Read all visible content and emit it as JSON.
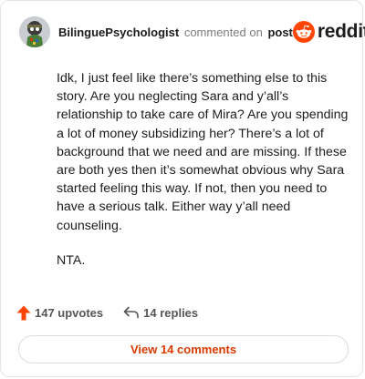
{
  "header": {
    "username": "BilinguePsychologist",
    "commented_text": "commented on",
    "post_link": "post",
    "brand": "reddit"
  },
  "comment": {
    "paragraphs": [
      "Idk, I just feel like there’s something else to this story. Are you neglecting Sara and y’all’s relationship to take care of Mira? Are you spending a lot of money subsidizing her? There’s a lot of background that we need and are missing. If these are both yes then it’s somewhat obvious why Sara started feeling this way. If not, then you need to have a serious talk. Either way y’all need counseling.",
      "NTA."
    ]
  },
  "actions": {
    "upvotes": "147 upvotes",
    "replies": "14 replies",
    "upvote_icon": "upvote-arrow-icon",
    "reply_icon": "reply-arrow-icon"
  },
  "view_comments": "View 14 comments",
  "colors": {
    "accent": "#d93a00",
    "reddit_orange": "#ff4500",
    "upvote": "#ff4500",
    "text": "#1c1c1c",
    "muted": "#7c7c7c"
  }
}
